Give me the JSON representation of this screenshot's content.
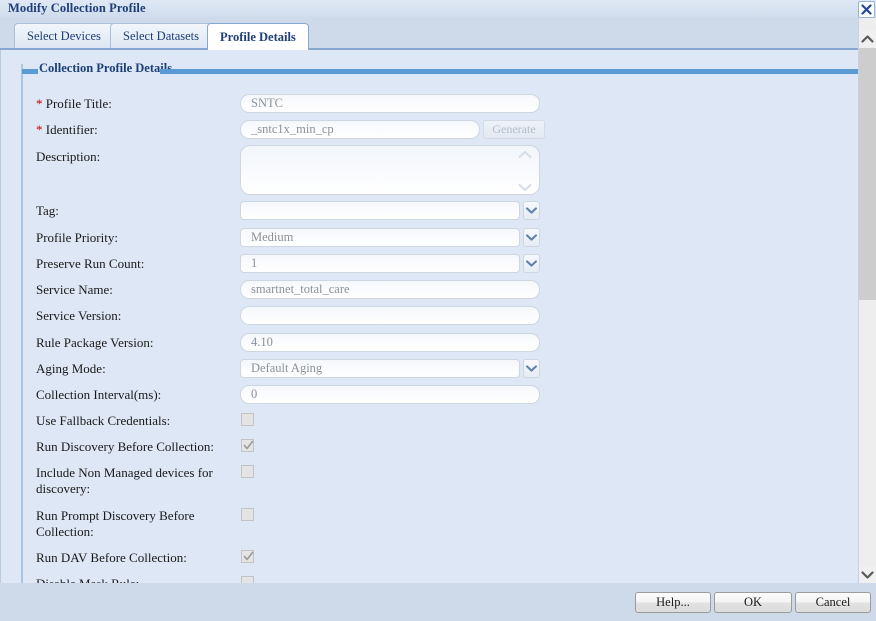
{
  "window": {
    "title": "Modify Collection Profile",
    "close_icon": "close-x-icon"
  },
  "tabs": [
    {
      "label": "Select Devices",
      "active": false
    },
    {
      "label": "Select Datasets",
      "active": false
    },
    {
      "label": "Profile Details",
      "active": true
    }
  ],
  "section": {
    "legend": "Collection Profile Details"
  },
  "fields": {
    "profile_title": {
      "label": "Profile Title:",
      "required": true,
      "value": "SNTC"
    },
    "identifier": {
      "label": "Identifier:",
      "required": true,
      "value": "_sntc1x_min_cp",
      "button": "Generate"
    },
    "description": {
      "label": "Description:",
      "value": ""
    },
    "tag": {
      "label": "Tag:",
      "value": ""
    },
    "profile_priority": {
      "label": "Profile Priority:",
      "value": "Medium"
    },
    "preserve_run_count": {
      "label": "Preserve Run Count:",
      "value": "1"
    },
    "service_name": {
      "label": "Service Name:",
      "value": "smartnet_total_care"
    },
    "service_version": {
      "label": "Service Version:",
      "value": ""
    },
    "rule_package_version": {
      "label": "Rule Package Version:",
      "value": "4.10"
    },
    "aging_mode": {
      "label": "Aging Mode:",
      "value": "Default Aging"
    },
    "collection_interval": {
      "label": "Collection Interval(ms):",
      "value": "0"
    },
    "use_fallback_credentials": {
      "label": "Use Fallback Credentials:",
      "checked": false
    },
    "run_discovery_before_collection": {
      "label": "Run Discovery Before Collection:",
      "checked": true
    },
    "include_non_managed": {
      "label": "Include Non Managed devices for discovery:",
      "checked": false
    },
    "run_prompt_discovery": {
      "label": "Run Prompt Discovery Before Collection:",
      "checked": false
    },
    "run_dav_before_collection": {
      "label": "Run DAV Before Collection:",
      "checked": true
    },
    "disable_mask_rule": {
      "label": "Disable Mask Rule:",
      "checked": false
    }
  },
  "footer": {
    "help": "Help...",
    "ok": "OK",
    "cancel": "Cancel"
  },
  "colors": {
    "title_text": "#1f3d7a",
    "required_marker": "#cc0000",
    "panel_bg": "#dde7f5",
    "dialog_bg": "#cedaea",
    "legend_bar": "#5b9bd5"
  }
}
